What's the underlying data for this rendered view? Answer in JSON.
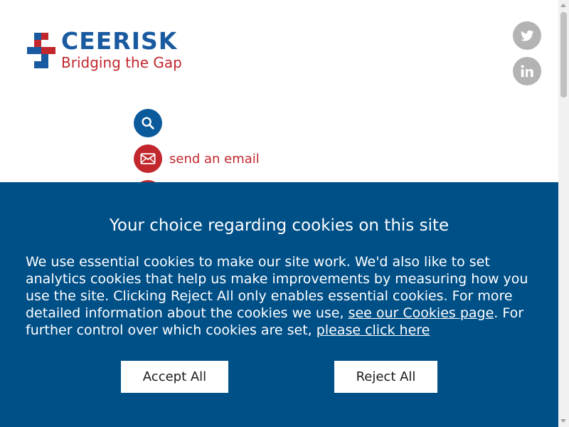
{
  "logo": {
    "title": "CEERISK",
    "tagline": "Bridging the Gap"
  },
  "social": [
    {
      "name": "twitter",
      "icon": "twitter-icon"
    },
    {
      "name": "linkedin",
      "icon": "linkedin-icon"
    }
  ],
  "actions": {
    "search": {
      "icon": "search-icon",
      "color": "#0a5a9c"
    },
    "email": {
      "icon": "envelope-icon",
      "label": "send an email",
      "color": "#c1272d"
    }
  },
  "cookie_banner": {
    "title": "Your choice regarding cookies on this site",
    "text_1": "We use essential cookies to make our site work. We'd also like to set analytics cookies that help us make improvements by measuring how you use the site. Clicking Reject All only enables essential cookies. For more detailed information about the cookies we use, ",
    "link_cookies_page": "see our Cookies page",
    "text_2": ". For further control over which cookies are set, ",
    "link_click_here": "please click here",
    "accept_label": "Accept All",
    "reject_label": "Reject All",
    "background_color": "#005088"
  }
}
